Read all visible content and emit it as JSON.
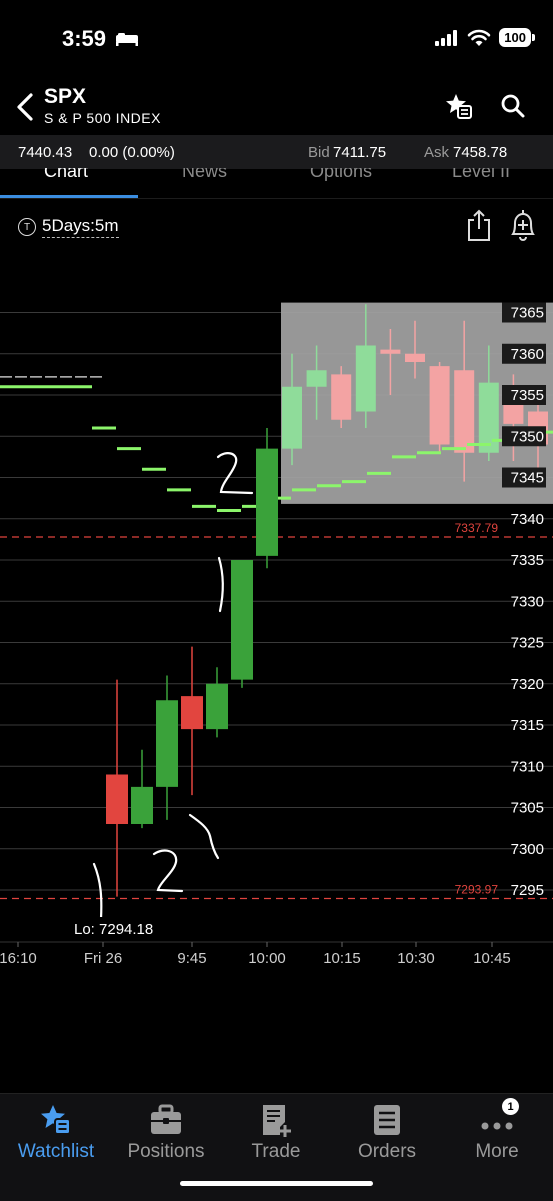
{
  "status": {
    "time": "3:59",
    "battery": "100"
  },
  "header": {
    "symbol": "SPX",
    "name": "S & P 500 INDEX"
  },
  "quote": {
    "last": "7440.43",
    "change": "0.00 (0.00%)",
    "bid_label": "Bid",
    "bid": "7411.75",
    "ask_label": "Ask",
    "ask": "7458.78"
  },
  "tabs": [
    {
      "label": "Chart",
      "active": true
    },
    {
      "label": "News"
    },
    {
      "label": "Options"
    },
    {
      "label": "Level II"
    }
  ],
  "chart_toolbar": {
    "period_icon": "T",
    "period": "5Days:5m"
  },
  "colors": {
    "up": "#3aa23a",
    "down": "#e2453f",
    "up_overlay": "#8fdc9a",
    "down_overlay": "#f3a3a3",
    "ma": "#8cf56b",
    "ref_line": "#e0443e",
    "accent": "#4a9df0"
  },
  "chart_data": {
    "type": "candlestick",
    "y_ticks": [
      7295,
      7300,
      7305,
      7310,
      7315,
      7320,
      7325,
      7330,
      7335,
      7340,
      7345,
      7350,
      7355,
      7360,
      7365
    ],
    "x_ticks": [
      "16:10",
      "Fri 26",
      "9:45",
      "10:00",
      "10:15",
      "10:30",
      "10:45"
    ],
    "reference_lines": [
      {
        "value": 7337.79,
        "label": "7337.79"
      },
      {
        "value": 7293.97,
        "label": "7293.97"
      }
    ],
    "low_label": "Lo: 7294.18",
    "candles": [
      {
        "time": "9:30",
        "open": 7309.0,
        "high": 7320.5,
        "low": 7294.2,
        "close": 7303.0
      },
      {
        "time": "9:35",
        "open": 7303.0,
        "high": 7312.0,
        "low": 7302.5,
        "close": 7307.5
      },
      {
        "time": "9:40",
        "open": 7307.5,
        "high": 7321.0,
        "low": 7303.5,
        "close": 7318.0
      },
      {
        "time": "9:45",
        "open": 7318.5,
        "high": 7324.5,
        "low": 7306.5,
        "close": 7314.5
      },
      {
        "time": "9:50",
        "open": 7314.5,
        "high": 7322.0,
        "low": 7313.5,
        "close": 7320.0
      },
      {
        "time": "9:55",
        "open": 7320.5,
        "high": 7334.5,
        "low": 7319.5,
        "close": 7335.0
      },
      {
        "time": "10:00",
        "open": 7335.5,
        "high": 7351.0,
        "low": 7334.0,
        "close": 7348.5
      }
    ],
    "overlay_candles": [
      {
        "open": 7348.5,
        "high": 7360.0,
        "low": 7346.5,
        "close": 7356.0
      },
      {
        "open": 7356.0,
        "high": 7361.0,
        "low": 7352.0,
        "close": 7358.0
      },
      {
        "open": 7357.5,
        "high": 7358.5,
        "low": 7351.0,
        "close": 7352.0
      },
      {
        "open": 7353.0,
        "high": 7366.0,
        "low": 7351.0,
        "close": 7361.0
      },
      {
        "open": 7360.5,
        "high": 7363.0,
        "low": 7355.0,
        "close": 7360.0
      },
      {
        "open": 7360.0,
        "high": 7364.0,
        "low": 7357.0,
        "close": 7359.0
      },
      {
        "open": 7358.5,
        "high": 7359.0,
        "low": 7348.0,
        "close": 7349.0
      },
      {
        "open": 7358.0,
        "high": 7364.0,
        "low": 7344.5,
        "close": 7348.0
      },
      {
        "open": 7348.0,
        "high": 7361.0,
        "low": 7347.0,
        "close": 7356.5
      },
      {
        "open": 7355.5,
        "high": 7357.5,
        "low": 7347.0,
        "close": 7351.5
      },
      {
        "open": 7353.0,
        "high": 7355.0,
        "low": 7344.0,
        "close": 7349.0
      }
    ],
    "ma_segments": [
      {
        "y": 7356.0
      },
      {
        "y": 7351.0
      },
      {
        "y": 7348.5
      },
      {
        "y": 7346.0
      },
      {
        "y": 7343.5
      },
      {
        "y": 7341.5
      },
      {
        "y": 7341.0
      },
      {
        "y": 7341.5
      },
      {
        "y": 7342.5
      },
      {
        "y": 7343.5
      },
      {
        "y": 7344.0
      },
      {
        "y": 7344.5
      },
      {
        "y": 7345.5
      },
      {
        "y": 7347.5
      },
      {
        "y": 7348.0
      },
      {
        "y": 7348.5
      },
      {
        "y": 7349.0
      },
      {
        "y": 7349.5
      },
      {
        "y": 7350.0
      },
      {
        "y": 7350.5
      }
    ]
  },
  "nav": [
    {
      "label": "Watchlist",
      "icon": "watchlist-star-icon",
      "active": true
    },
    {
      "label": "Positions",
      "icon": "briefcase-icon"
    },
    {
      "label": "Trade",
      "icon": "trade-ticket-icon"
    },
    {
      "label": "Orders",
      "icon": "orders-list-icon"
    },
    {
      "label": "More",
      "icon": "more-dots-icon",
      "badge": "1"
    }
  ]
}
